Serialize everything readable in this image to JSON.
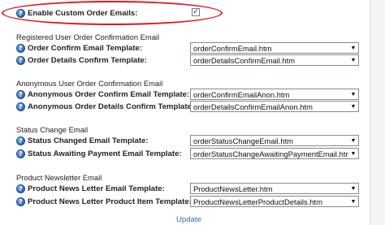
{
  "enable_custom": {
    "label": "Enable Custom Order Emails:",
    "checked_mark": "✓"
  },
  "sections": [
    {
      "title": "Registered User Order Confirmation Email",
      "rows": [
        {
          "label": "Order Confirm Email Template:",
          "value": "orderConfirmEmail.htm"
        },
        {
          "label": "Order Details Confirm Template:",
          "value": "orderDetailsConfirmEmail.htm"
        }
      ]
    },
    {
      "title": "Anonymous User Order Confirmation Email",
      "rows": [
        {
          "label": "Anonymous Order Confirm Email Template:",
          "value": "orderConfirmEmailAnon.htm"
        },
        {
          "label": "Anonymous Order Details Confirm Template:",
          "value": "orderDetailsConfirmEmailAnon.htm"
        }
      ]
    },
    {
      "title": "Status Change Email",
      "rows": [
        {
          "label": "Status Changed Email Template:",
          "value": "orderStatusChangeEmail.htm"
        },
        {
          "label": "Status Awaiting Payment Email Template:",
          "value": "orderStatusChangeAwaitingPaymentEmail.htm"
        }
      ]
    },
    {
      "title": "Product Newsletter Email",
      "rows": [
        {
          "label": "Product News Letter Email Template:",
          "value": "ProductNewsLetter.htm"
        },
        {
          "label": "Product News Letter Product Item Template:",
          "value": "ProductNewsLetterProductDetails.htm"
        }
      ]
    }
  ],
  "update_link": "Update",
  "icons": {
    "help": "help-icon",
    "dropdown": "chevron-down-icon"
  },
  "colors": {
    "highlight": "#e01b24",
    "link": "#2b6fb6"
  }
}
